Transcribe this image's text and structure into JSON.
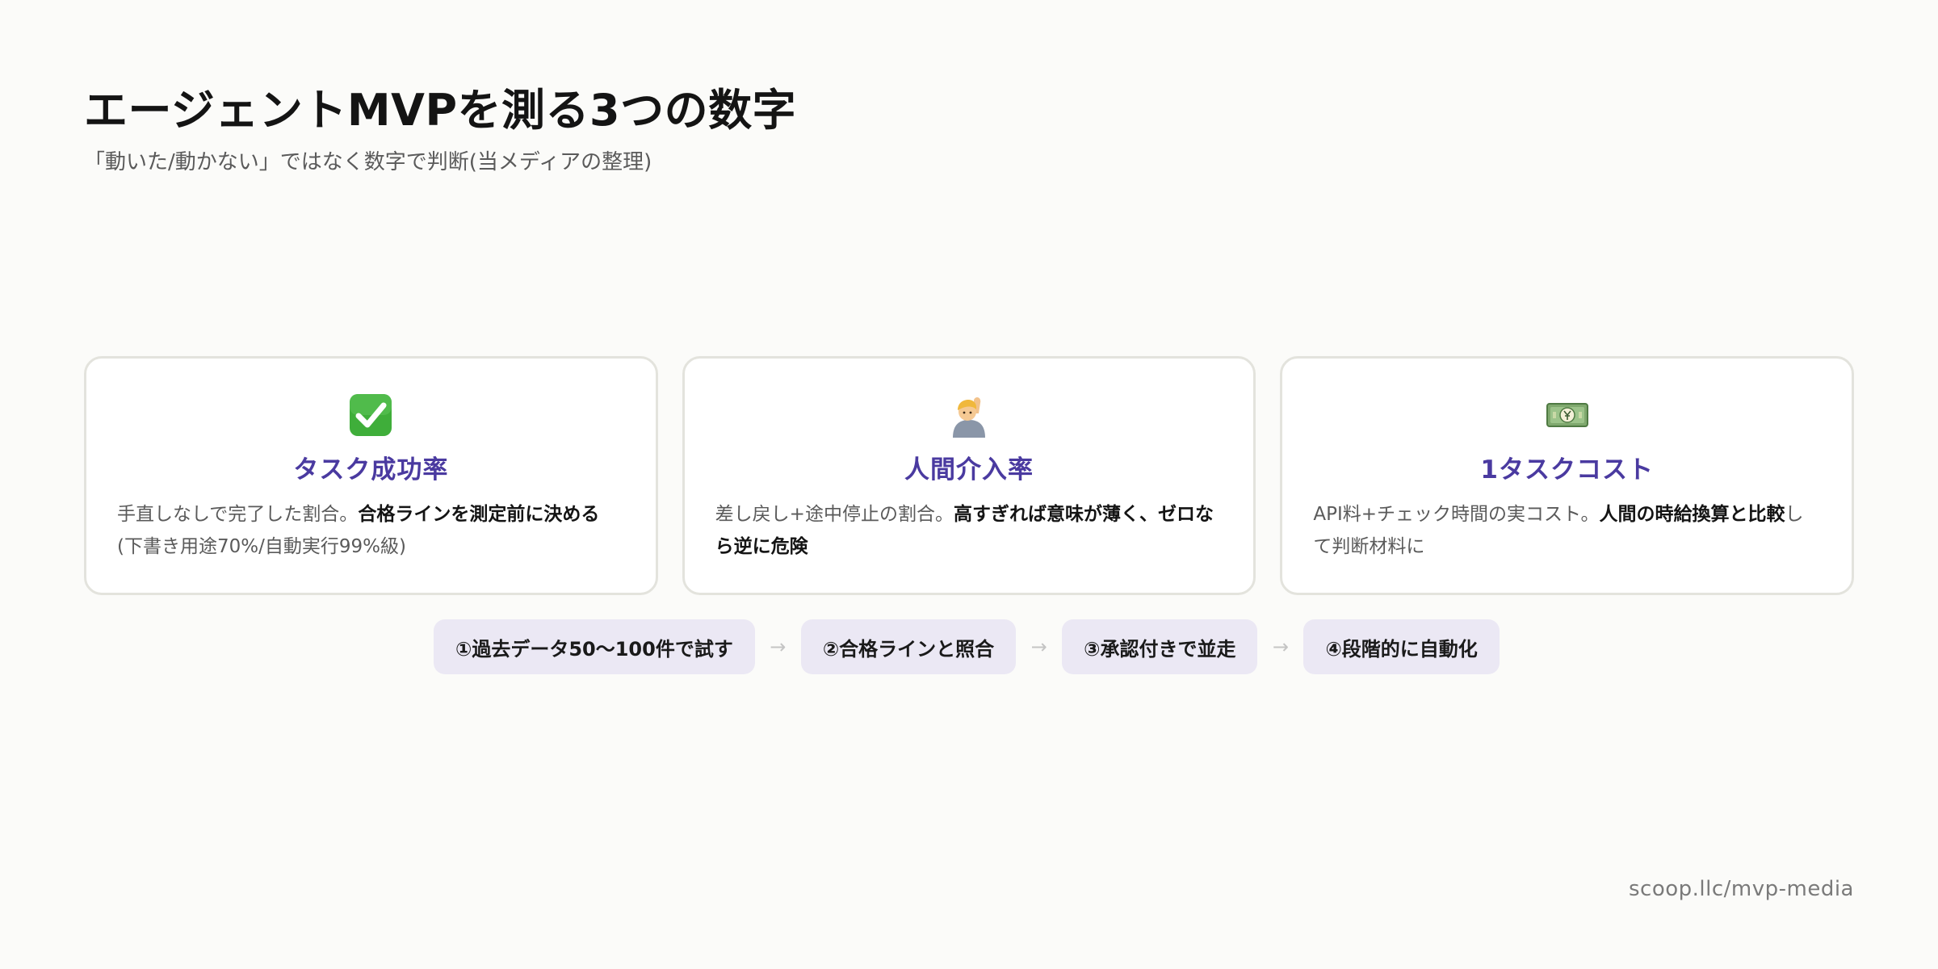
{
  "title": "エージェントMVPを測る3つの数字",
  "subtitle": "「動いた/動かない」ではなく数字で判断(当メディアの整理)",
  "cards": [
    {
      "icon": "check-mark-icon",
      "title": "タスク成功率",
      "desc_prefix": "手直しなしで完了した割合。",
      "desc_bold": "合格ラインを測定前に決める",
      "desc_suffix": "(下書き用途70%/自動実行99%級)"
    },
    {
      "icon": "raising-hand-person-icon",
      "title": "人間介入率",
      "desc_prefix": "差し戻し+途中停止の割合。",
      "desc_bold": "高すぎれば意味が薄く、ゼロなら逆に危険",
      "desc_suffix": ""
    },
    {
      "icon": "money-bill-icon",
      "title": "1タスクコスト",
      "desc_prefix": "API料+チェック時間の実コスト。",
      "desc_bold": "人間の時給換算と比較",
      "desc_suffix": "して判断材料に"
    }
  ],
  "steps": [
    "①過去データ50〜100件で試す",
    "②合格ラインと照合",
    "③承認付きで並走",
    "④段階的に自動化"
  ],
  "arrow": "→",
  "footer": "scoop.llc/mvp-media",
  "colors": {
    "background": "#fbfbf9",
    "accent": "#4a3aa0",
    "step_bg": "#ebe8f4",
    "card_border": "#e3e3dd"
  }
}
